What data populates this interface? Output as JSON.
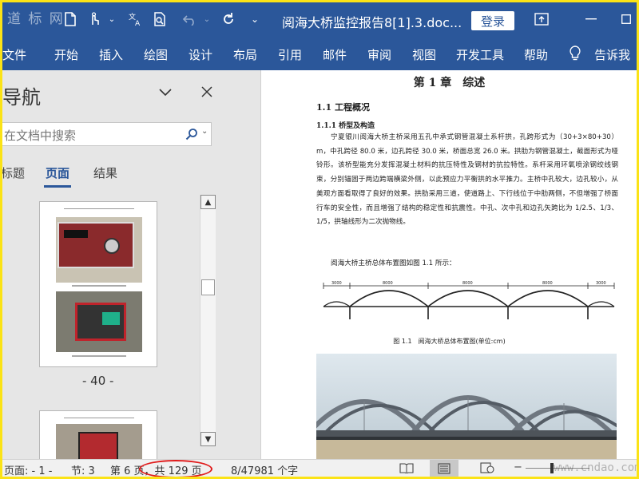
{
  "titlebar": {
    "watermark": "道 标 网",
    "doc_title": "阅海大桥监控报告8[1].3.doc...",
    "login_label": "登录"
  },
  "ribbon": {
    "tabs": [
      "文件",
      "开始",
      "插入",
      "绘图",
      "设计",
      "布局",
      "引用",
      "邮件",
      "审阅",
      "视图",
      "开发工具",
      "帮助",
      "告诉我"
    ]
  },
  "nav": {
    "title": "导航",
    "search_placeholder": "在文档中搜索",
    "tabs": [
      "标题",
      "页面",
      "结果"
    ],
    "page_label": "- 40 -"
  },
  "document": {
    "chapter_title": "第 1 章　综述",
    "section_1": "1.1 工程概况",
    "section_1_1": "1.1.1 桥型及构造",
    "paragraph_1": "宁夏银川阅海大桥主桥采用五孔中承式钢管混凝土系杆拱，孔跨形式为（30+3×80+30）m，中孔跨径 80.0 米，边孔跨径 30.0 米，桥面总宽 26.0 米。拱肋为钢管混凝土，截面形式为哑铃形。该桥型能充分发挥混凝土材料的抗压特性及钢材的抗拉特性。系杆采用环氧喷涂钢绞线钢束，分别锚固于两边跨端横梁外侧，以此预应力平衡拱的水平推力。主桥中孔较大，边孔较小，从美观方面看取得了良好的效果。拱肋采用三道，使道路上、下行线位于中肋两侧，不但增强了桥面行车的安全性，而且增强了结构的稳定性和抗震性。中孔、次中孔和边孔矢跨比为 1/2.5、1/3、1/5，拱轴线形为二次抛物线。",
    "paragraph_2": "阅海大桥主桥总体布置图如图 1.1 所示：",
    "dimensions": [
      "3000",
      "8000",
      "8000",
      "8000",
      "3000"
    ],
    "figure_caption": "图 1.1　阅海大桥总体布置图(单位:cm)"
  },
  "statusbar": {
    "page_info": "页面: - 1 -",
    "section": "节: 3",
    "page_count": "第 6 页，共 129 页",
    "words": "8/47981 个字",
    "site_watermark": "www.cndao.com"
  },
  "colors": {
    "accent": "#2b579a",
    "frame": "#fbe316",
    "annotation": "#e01b1b"
  }
}
